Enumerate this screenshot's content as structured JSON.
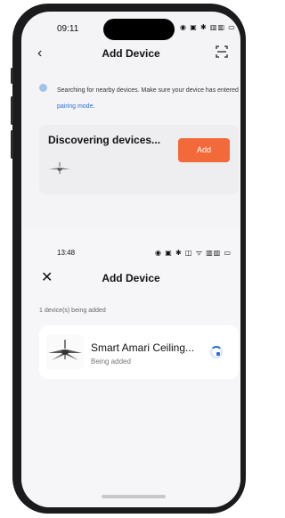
{
  "top_screen": {
    "status_time": "09:11",
    "title": "Add Device",
    "search_message_prefix": "Searching for nearby devices. Make sure your device has entered",
    "search_message_link": "pairing mode",
    "search_message_suffix": ".",
    "discover_title": "Discovering devices...",
    "add_label": "Add"
  },
  "bottom_screen": {
    "status_time": "13:48",
    "title": "Add Device",
    "count_text": "1 device(s) being added",
    "device_name": "Smart Amari Ceiling...",
    "device_status": "Being added"
  },
  "colors": {
    "accent": "#f26a3a",
    "link": "#2a6fdb"
  },
  "icons": {
    "back": "chevron-left-icon",
    "scan": "scan-icon",
    "close": "close-icon",
    "fan": "ceiling-fan-icon",
    "spinner": "loading-spinner-icon"
  }
}
